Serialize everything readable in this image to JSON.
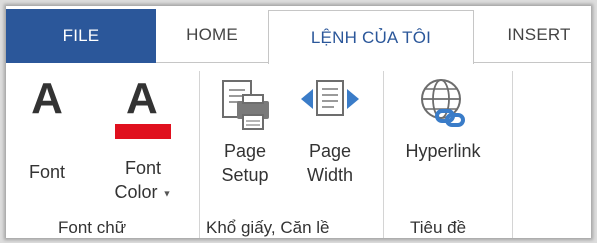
{
  "tabs": {
    "file": "FILE",
    "home": "HOME",
    "custom": "LỆNH CỦA TÔI",
    "insert": "INSERT"
  },
  "groups": {
    "font": {
      "label": "Font chữ",
      "font_button": "Font",
      "font_color_button": [
        "Font",
        "Color"
      ]
    },
    "page": {
      "label": "Khổ giấy, Căn lề",
      "page_setup_button": [
        "Page",
        "Setup"
      ],
      "page_width_button": [
        "Page",
        "Width"
      ]
    },
    "links": {
      "label": "Tiêu đề",
      "hyperlink_button": "Hyperlink"
    }
  },
  "icons": {
    "font": "font-a-icon",
    "font_color": "font-color-icon",
    "page_setup": "printer-page-icon",
    "page_width": "page-width-icon",
    "hyperlink": "globe-link-icon"
  },
  "colors": {
    "file_tab": "#2b579a",
    "active_tab_text": "#2b579a",
    "font_color_bar": "#e0101e",
    "icon_blue": "#3a7cc8"
  }
}
